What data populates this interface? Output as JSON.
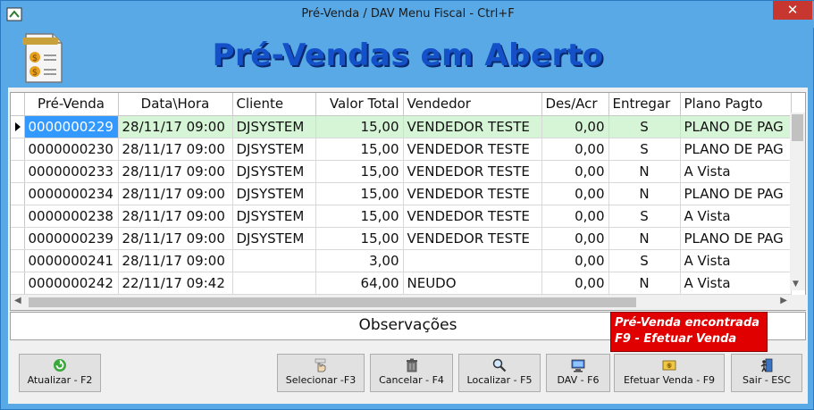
{
  "window": {
    "title": "Pré-Venda / DAV      Menu Fiscal - Ctrl+F",
    "close_label": "✕"
  },
  "header": {
    "title": "Pré-Vendas em Aberto"
  },
  "grid": {
    "columns": [
      "Pré-Venda",
      "Data\\Hora",
      "Cliente",
      "Valor Total",
      "Vendedor",
      "Des/Acr",
      "Entregar",
      "Plano Pagto"
    ],
    "rows": [
      [
        "0000000229",
        "28/11/17 09:00",
        "DJSYSTEM",
        "15,00",
        "VENDEDOR TESTE",
        "0,00",
        "S",
        "PLANO DE PAG"
      ],
      [
        "0000000230",
        "28/11/17 09:00",
        "DJSYSTEM",
        "15,00",
        "VENDEDOR TESTE",
        "0,00",
        "S",
        "PLANO DE PAG"
      ],
      [
        "0000000233",
        "28/11/17 09:00",
        "DJSYSTEM",
        "15,00",
        "VENDEDOR TESTE",
        "0,00",
        "N",
        "A Vista"
      ],
      [
        "0000000234",
        "28/11/17 09:00",
        "DJSYSTEM",
        "15,00",
        "VENDEDOR TESTE",
        "0,00",
        "N",
        "PLANO DE PAG"
      ],
      [
        "0000000238",
        "28/11/17 09:00",
        "DJSYSTEM",
        "15,00",
        "VENDEDOR TESTE",
        "0,00",
        "S",
        "A Vista"
      ],
      [
        "0000000239",
        "28/11/17 09:00",
        "DJSYSTEM",
        "15,00",
        "VENDEDOR TESTE",
        "0,00",
        "N",
        "PLANO DE PAG"
      ],
      [
        "0000000241",
        "28/11/17 09:00",
        "",
        "3,00",
        "",
        "0,00",
        "S",
        "A Vista"
      ],
      [
        "0000000242",
        "22/11/17 09:42",
        "",
        "64,00",
        "NEUDO",
        "0,00",
        "N",
        "A Vista"
      ]
    ],
    "selected_row": 0
  },
  "observations": {
    "label": "Observações"
  },
  "status": {
    "line1": "Pré-Venda encontrada",
    "line2": "F9 - Efetuar Venda"
  },
  "buttons": {
    "refresh": "Atualizar - F2",
    "select": "Selecionar -F3",
    "cancel": "Cancelar - F4",
    "search": "Localizar - F5",
    "dav": "DAV - F6",
    "checkout": "Efetuar Venda - F9",
    "exit": "Sair - ESC"
  },
  "colors": {
    "titlebar": "#59a9e6",
    "title_text": "#1450c8",
    "selected_row": "#d6f5d6",
    "selected_cell": "#3399ff",
    "status_bg": "#e00000"
  }
}
